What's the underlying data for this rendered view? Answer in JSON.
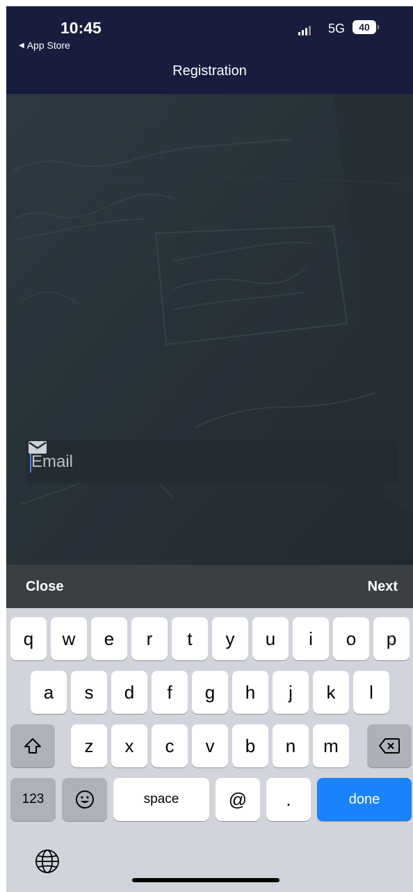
{
  "status": {
    "time": "10:45",
    "back_app": "App Store",
    "network": "5G",
    "battery": "40"
  },
  "nav": {
    "title": "Registration"
  },
  "form": {
    "email_placeholder": "Email"
  },
  "accessory": {
    "close_label": "Close",
    "next_label": "Next"
  },
  "keyboard": {
    "row1": [
      "q",
      "w",
      "e",
      "r",
      "t",
      "y",
      "u",
      "i",
      "o",
      "p"
    ],
    "row2": [
      "a",
      "s",
      "d",
      "f",
      "g",
      "h",
      "j",
      "k",
      "l"
    ],
    "row3": [
      "z",
      "x",
      "c",
      "v",
      "b",
      "n",
      "m"
    ],
    "numbers_label": "123",
    "space_label": "space",
    "at_label": "@",
    "dot_label": ".",
    "done_label": "done"
  }
}
